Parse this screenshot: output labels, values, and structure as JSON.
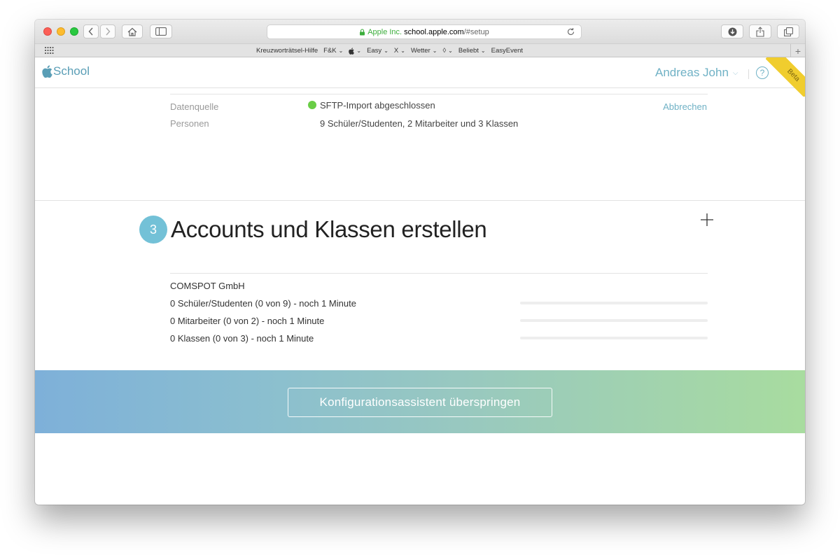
{
  "browser": {
    "url_secure_label": "Apple Inc.",
    "url_host": "school.apple.com",
    "url_path": "/#setup",
    "bookmarks": [
      {
        "label": "Kreuzworträtsel-Hilfe",
        "has_menu": false
      },
      {
        "label": "F&K",
        "has_menu": true
      },
      {
        "label": "",
        "has_menu": true,
        "icon": "apple-icon"
      },
      {
        "label": "Easy",
        "has_menu": true
      },
      {
        "label": "X",
        "has_menu": true
      },
      {
        "label": "Wetter",
        "has_menu": true
      },
      {
        "label": "◊",
        "has_menu": true
      },
      {
        "label": "Beliebt",
        "has_menu": true
      },
      {
        "label": "EasyEvent",
        "has_menu": false
      }
    ],
    "bookmark_chevron": "⌄",
    "add_tab": "+"
  },
  "header": {
    "logo_text": "School",
    "user_name": "Andreas John",
    "user_chevron": "⌵",
    "help_symbol": "?",
    "beta_label": "Beta"
  },
  "section_source": {
    "rows": [
      {
        "label": "Datenquelle",
        "value": "SFTP-Import abgeschlossen"
      },
      {
        "label": "Personen",
        "value": "9 Schüler/Studenten, 2 Mitarbeiter und 3 Klassen"
      }
    ],
    "cancel_label": "Abbrechen",
    "status_color": "#69cd46"
  },
  "section_accounts": {
    "step_number": "3",
    "title": "Accounts und Klassen erstellen",
    "organization": "COMSPOT GmbH",
    "progress": [
      {
        "label": "0 Schüler/Studenten (0 von 9) - noch 1 Minute",
        "fraction": 0
      },
      {
        "label": "0 Mitarbeiter (0 von 2) - noch 1 Minute",
        "fraction": 0
      },
      {
        "label": "0 Klassen (0 von 3) - noch 1 Minute",
        "fraction": 0
      }
    ]
  },
  "footer": {
    "skip_label": "Konfigurationsassistent überspringen"
  },
  "colors": {
    "accent": "#6fb1c5",
    "step_circle": "#73c1d7",
    "beta": "#f0cd2e"
  }
}
